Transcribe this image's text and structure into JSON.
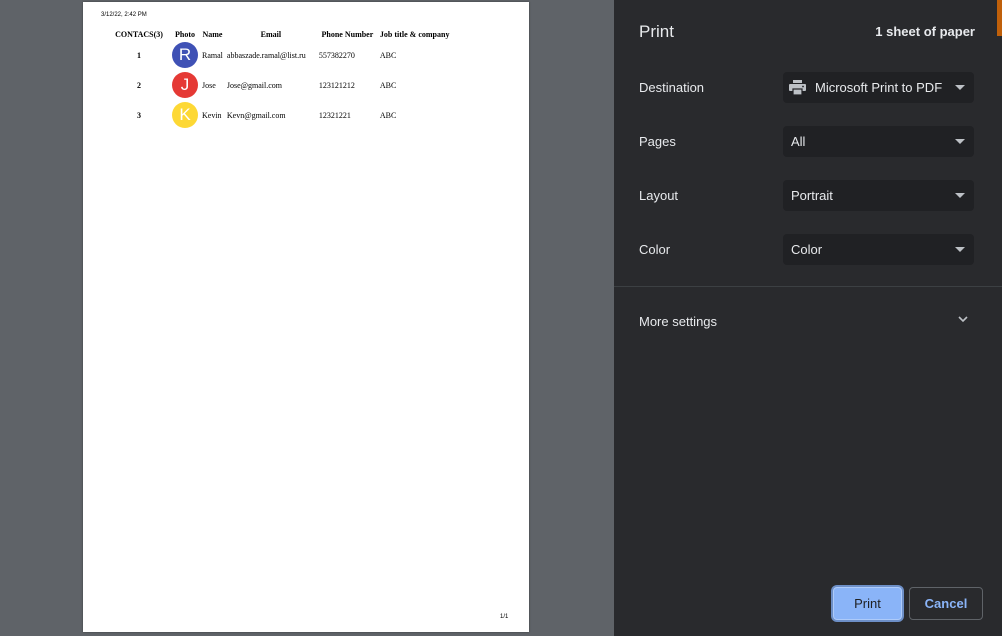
{
  "document": {
    "date_time": "3/12/22, 2:42 PM",
    "page_number": "1/1",
    "headers": [
      "CONTACS(3)",
      "Photo",
      "Name",
      "Email",
      "Phone Number",
      "Job title & company"
    ],
    "rows": [
      {
        "num": "1",
        "initial": "R",
        "avatar_color": "#3f51b5",
        "name": "Ramal",
        "email": "abbaszade.ramal@list.ru",
        "phone": "557382270",
        "job": "ABC"
      },
      {
        "num": "2",
        "initial": "J",
        "avatar_color": "#e53935",
        "name": "Jose",
        "email": "Jose@gmail.com",
        "phone": "123121212",
        "job": "ABC"
      },
      {
        "num": "3",
        "initial": "K",
        "avatar_color": "#fdd835",
        "name": "Kevin",
        "email": "Kevn@gmail.com",
        "phone": "12321221",
        "job": "ABC"
      }
    ]
  },
  "panel": {
    "title": "Print",
    "sheet_count": "1 sheet of paper",
    "destination": {
      "label": "Destination",
      "value": "Microsoft Print to PDF",
      "icon": "printer-icon"
    },
    "pages": {
      "label": "Pages",
      "value": "All"
    },
    "layout": {
      "label": "Layout",
      "value": "Portrait"
    },
    "color": {
      "label": "Color",
      "value": "Color"
    },
    "more_settings": {
      "label": "More settings",
      "icon": "chevron-down-icon"
    },
    "buttons": {
      "print": "Print",
      "cancel": "Cancel"
    },
    "colors": {
      "panel_bg": "#292a2d",
      "accent": "#8ab4f8",
      "select_bg": "#202124"
    }
  }
}
